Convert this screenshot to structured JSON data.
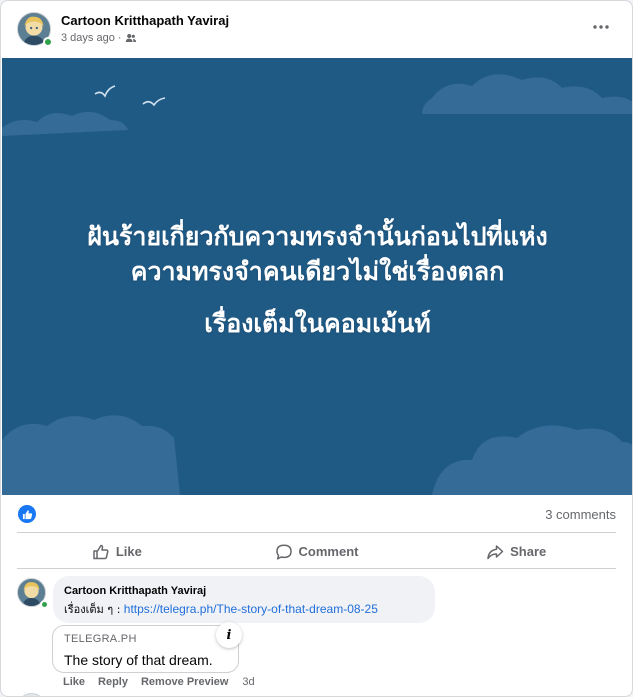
{
  "post": {
    "author_name": "Cartoon Kritthapath Yaviraj",
    "time": "3 days ago",
    "meta_separator": "·",
    "audience_icon": "friends-icon",
    "more_icon": "more-horizontal-icon"
  },
  "banner": {
    "line1": "ฝันร้ายเกี่ยวกับความทรงจำนั้นก่อนไปที่แห่ง",
    "line2": "ความทรงจำคนเดียวไม่ใช่เรื่องตลก",
    "line3": "เรื่องเต็มในคอมเม้นท์",
    "background_color": "#1f5a85",
    "cloud_color": "#3a6f9a"
  },
  "reactions": {
    "icon": "like-reaction-icon",
    "comments_count": "3 comments"
  },
  "actions": {
    "like": "Like",
    "comment": "Comment",
    "share": "Share"
  },
  "comment": {
    "author": "Cartoon Kritthapath Yaviraj",
    "text_prefix": "เรื่องเต็ม ๆ :",
    "link": "https://telegra.ph/The-story-of-that-dream-08-25",
    "preview_domain": "TELEGRA.PH",
    "preview_title": "The story of that dream.",
    "info_label": "i",
    "like_label": "Like",
    "reply_label": "Reply",
    "remove_preview_label": "Remove Preview",
    "time": "3d"
  },
  "colors": {
    "accent": "#1877f2",
    "link": "#216fdb",
    "online": "#31a24c",
    "secondary_text": "#65676b"
  }
}
